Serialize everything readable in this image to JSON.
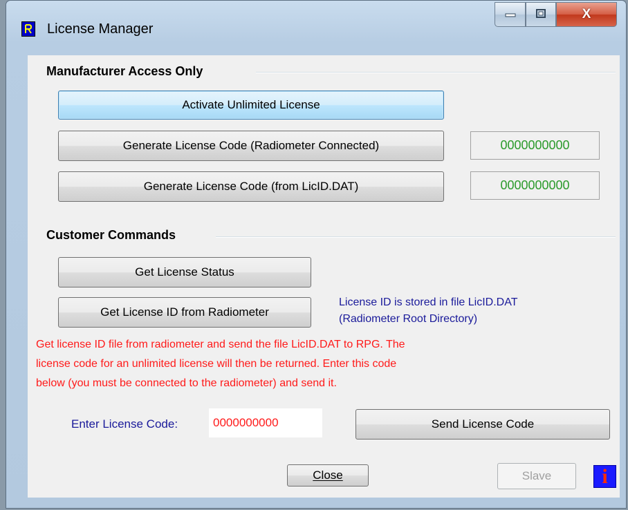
{
  "window": {
    "title": "License Manager",
    "minimize_glyph": "▭",
    "maximize_glyph": "□",
    "close_glyph": "X"
  },
  "manufacturer": {
    "heading": "Manufacturer Access Only",
    "activate_label": "Activate Unlimited License",
    "generate_connected_label": "Generate License Code (Radiometer Connected)",
    "generate_connected_code": "0000000000",
    "generate_file_label": "Generate License Code (from LicID.DAT)",
    "generate_file_code": "0000000000"
  },
  "customer": {
    "heading": "Customer Commands",
    "status_label": "Get License Status",
    "get_id_label": "Get License ID from Radiometer",
    "info_line1": "License ID is stored in file LicID.DAT",
    "info_line2": "(Radiometer Root Directory)",
    "instructions_line1": "Get license ID file from radiometer and send the file LicID.DAT to RPG.  The",
    "instructions_line2": "license code for an unlimited license will then be returned. Enter this code",
    "instructions_line3": "below (you must be connected to the radiometer) and send it.",
    "enter_label": "Enter License Code:",
    "enter_value": "0000000000",
    "send_label": "Send License Code"
  },
  "footer": {
    "close_label": "Close",
    "slave_label": "Slave",
    "info_glyph": "i"
  },
  "colors": {
    "code_green": "#2a9a2a",
    "info_blue": "#1a1a9a",
    "warning_red": "#ff1a1a"
  }
}
